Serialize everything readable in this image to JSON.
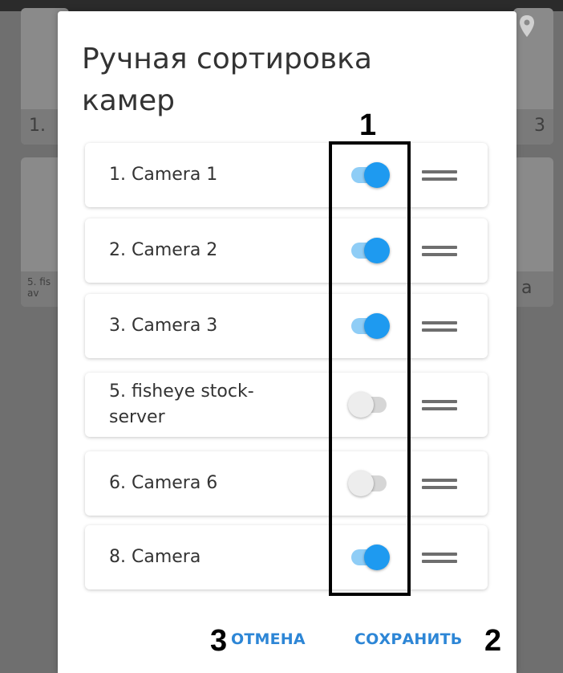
{
  "background": {
    "tiles": [
      {
        "caption": "1."
      },
      {
        "caption": "3"
      },
      {
        "caption": "5. fis\nav"
      },
      {
        "caption": "a"
      }
    ]
  },
  "dialog": {
    "title": "Ручная сортировка камер",
    "cameras": [
      {
        "label": "1. Camera 1",
        "enabled": true
      },
      {
        "label": "2. Camera 2",
        "enabled": true
      },
      {
        "label": "3. Camera 3",
        "enabled": true
      },
      {
        "label": "5. fisheye stock-server",
        "enabled": false
      },
      {
        "label": "6. Camera 6",
        "enabled": false
      },
      {
        "label": "8. Camera",
        "enabled": true
      }
    ],
    "cancel_label": "ОТМЕНА",
    "save_label": "СОХРАНИТЬ"
  },
  "annotations": {
    "toggles_marker": "1",
    "save_marker": "2",
    "cancel_marker": "3"
  },
  "colors": {
    "accent": "#1e9af0",
    "button_text": "#2d86d6",
    "toggle_track_on": "#8fcdf6",
    "toggle_off": "#d6d6d6"
  }
}
